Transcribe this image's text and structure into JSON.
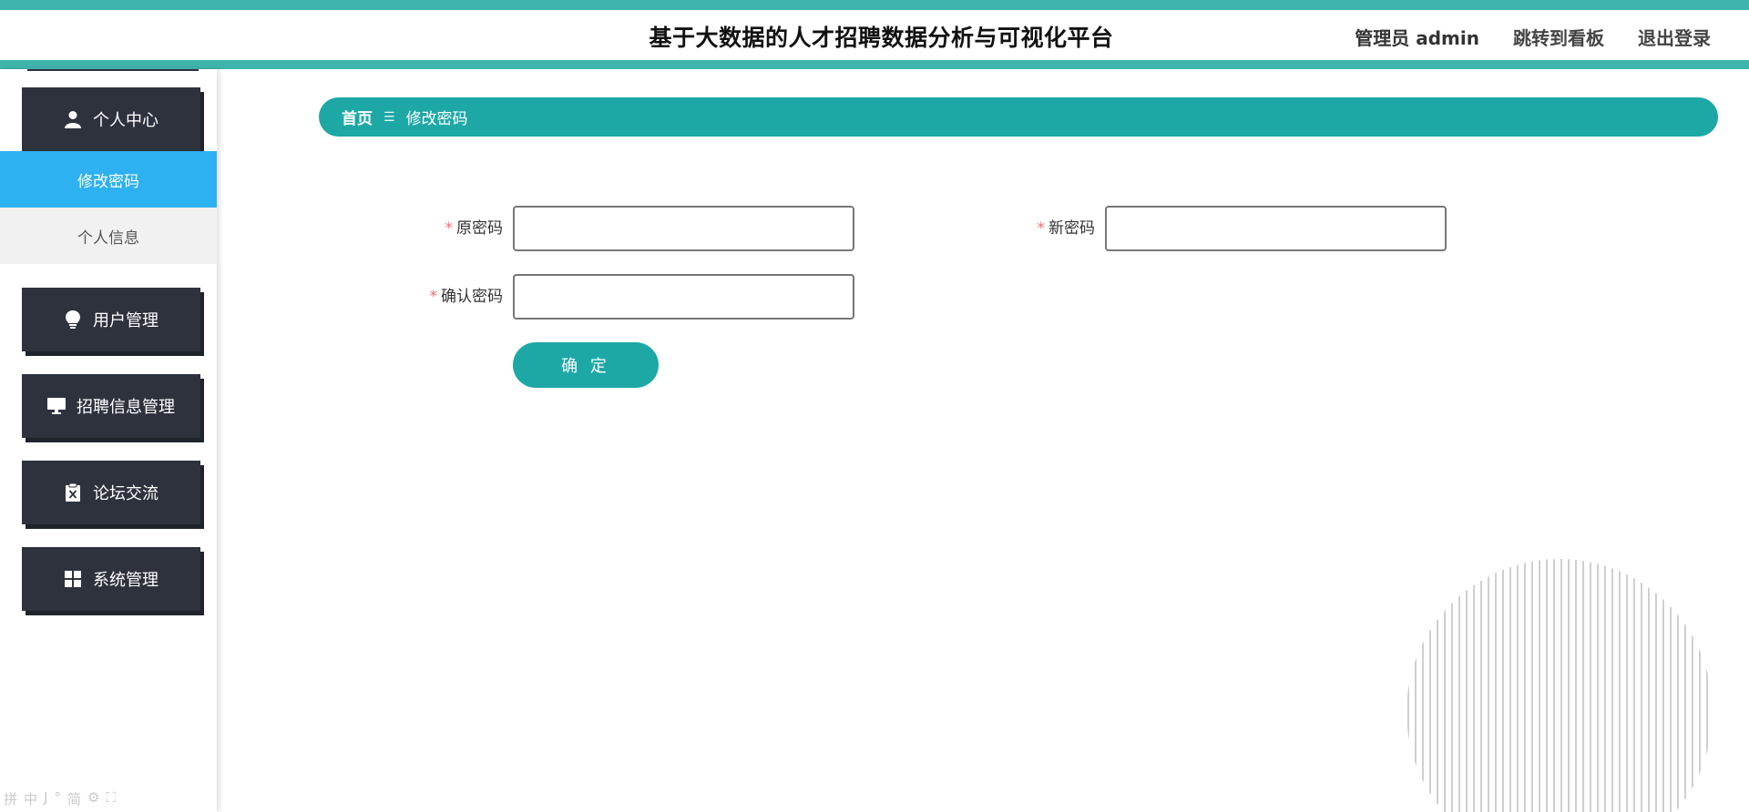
{
  "header": {
    "title": "基于大数据的人才招聘数据分析与可视化平台",
    "user_label": "管理员 admin",
    "dashboard_link": "跳转到看板",
    "logout_link": "退出登录"
  },
  "sidebar": {
    "groups": [
      {
        "label": "个人中心",
        "icon": "user-icon"
      },
      {
        "label": "用户管理",
        "icon": "lightbulb-icon"
      },
      {
        "label": "招聘信息管理",
        "icon": "monitor-icon"
      },
      {
        "label": "论坛交流",
        "icon": "clipboard-icon"
      },
      {
        "label": "系统管理",
        "icon": "grid-icon"
      }
    ],
    "sub_items": [
      {
        "label": "修改密码",
        "active": true
      },
      {
        "label": "个人信息",
        "active": false
      }
    ],
    "ime_toolbar": [
      "拼",
      "中",
      "J",
      "°",
      "简",
      "⚙",
      "⛶"
    ]
  },
  "breadcrumb": {
    "home": "首页",
    "current": "修改密码"
  },
  "form": {
    "old_password": {
      "label": "原密码",
      "required_mark": "*",
      "value": ""
    },
    "new_password": {
      "label": "新密码",
      "required_mark": "*",
      "value": ""
    },
    "confirm_password": {
      "label": "确认密码",
      "required_mark": "*",
      "value": ""
    },
    "submit_label": "确 定"
  },
  "colors": {
    "accent": "#1da8a6",
    "header_bar": "#3fb4ad",
    "menu_dark": "#2d323d",
    "active_item": "#2db1f0",
    "required": "#f56c6c"
  }
}
